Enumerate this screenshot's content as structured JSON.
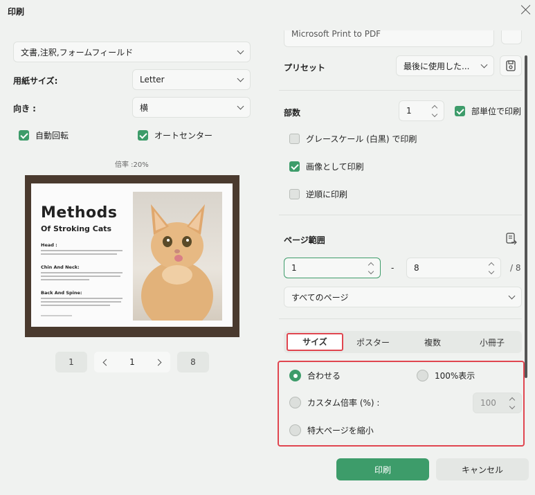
{
  "window": {
    "title": "印刷"
  },
  "left": {
    "content_select": "文書,注釈,フォームフィールド",
    "paper_size_label": "用紙サイズ:",
    "paper_size_value": "Letter",
    "orientation_label": "向き :",
    "orientation_value": "横",
    "auto_rotate": "自動回転",
    "auto_center": "オートセンター",
    "scale_text": "倍率 :20%",
    "preview": {
      "title": "Methods",
      "subtitle": "Of Stroking Cats",
      "head": "Head :",
      "chin": "Chin And Neck:",
      "back": "Back And Spine:"
    },
    "pager": {
      "first": "1",
      "current": "1",
      "last": "8"
    }
  },
  "right": {
    "printer_partial": "Microsoft Print to PDF",
    "preset_label": "プリセット",
    "preset_value": "最後に使用した...",
    "copies_label": "部数",
    "copies_value": "1",
    "collate_label": "部単位で印刷",
    "grayscale_label": "グレースケール (白黒) で印刷",
    "as_image_label": "画像として印刷",
    "reverse_label": "逆順に印刷",
    "page_range_label": "ページ範囲",
    "range_from": "1",
    "range_dash": "-",
    "range_to": "8",
    "range_total": "/ 8",
    "range_select": "すべてのページ",
    "tabs": [
      "サイズ",
      "ポスター",
      "複数",
      "小冊子"
    ],
    "fit_label": "合わせる",
    "actual_label": "100%表示",
    "custom_label": "カスタム倍率 (%) :",
    "custom_value": "100",
    "shrink_label": "特大ページを縮小"
  },
  "buttons": {
    "print": "印刷",
    "cancel": "キャンセル"
  },
  "colors": {
    "accent": "#3d9c6a",
    "highlight": "#e0454f"
  }
}
